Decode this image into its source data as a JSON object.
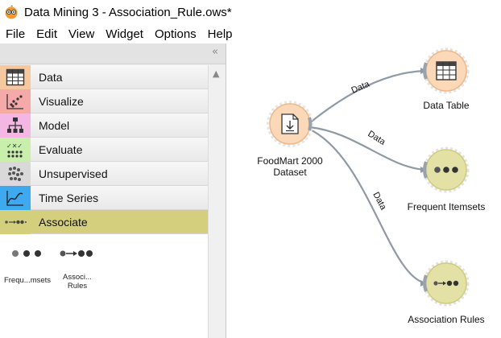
{
  "window": {
    "title": "Data Mining 3 - Association_Rule.ows*"
  },
  "menu": [
    "File",
    "Edit",
    "View",
    "Widget",
    "Options",
    "Help"
  ],
  "sidebar": {
    "collapse_label": "«",
    "categories": [
      {
        "label": "Data",
        "icon": "data-table-icon",
        "color": "#f6c8a0",
        "active": false
      },
      {
        "label": "Visualize",
        "icon": "scatter-icon",
        "color": "#f5a9a9",
        "active": false
      },
      {
        "label": "Model",
        "icon": "tree-icon",
        "color": "#f4b7e3",
        "active": false
      },
      {
        "label": "Evaluate",
        "icon": "evaluate-icon",
        "color": "#c9efad",
        "active": false
      },
      {
        "label": "Unsupervised",
        "icon": "clusters-icon",
        "color": "#d9d9d9",
        "active": false
      },
      {
        "label": "Time Series",
        "icon": "line-chart-icon",
        "color": "#3fa9f0",
        "active": false
      },
      {
        "label": "Associate",
        "icon": "associate-icon",
        "color": "#d3cf7d",
        "active": true
      }
    ],
    "widgets": [
      {
        "label": "Frequ...msets",
        "icon": "itemsets-icon"
      },
      {
        "label": "Associ...\nRules",
        "icon": "rules-icon"
      }
    ]
  },
  "canvas": {
    "nodes": [
      {
        "id": "foodmart",
        "label": "FoodMart 2000\nDataset",
        "icon": "download-file-icon",
        "color": "#fbd9b8"
      },
      {
        "id": "datatable",
        "label": "Data Table",
        "icon": "data-table-icon",
        "color": "#fbd9b8"
      },
      {
        "id": "itemsets",
        "label": "Frequent Itemsets",
        "icon": "itemsets-icon",
        "color": "#e3e1a6"
      },
      {
        "id": "rules",
        "label": "Association Rules",
        "icon": "rules-icon",
        "color": "#e3e1a6"
      }
    ],
    "links": [
      {
        "from": "foodmart",
        "to": "datatable",
        "label": "Data"
      },
      {
        "from": "foodmart",
        "to": "itemsets",
        "label": "Data"
      },
      {
        "from": "foodmart",
        "to": "rules",
        "label": "Data"
      }
    ]
  }
}
